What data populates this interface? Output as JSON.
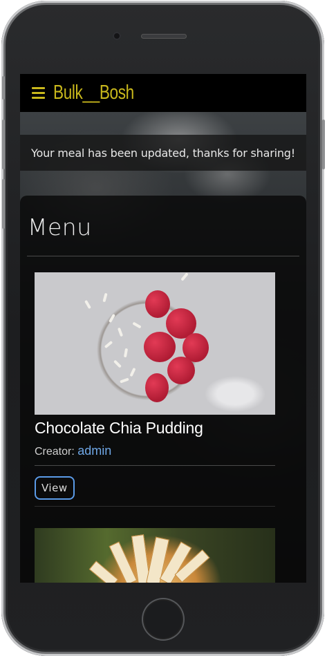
{
  "navbar": {
    "brand": "Bulk__Bosh",
    "brand_color": "#c9b81c"
  },
  "flash": {
    "message": "Your meal has been updated, thanks for sharing!"
  },
  "menu": {
    "title": "Menu",
    "recipes": [
      {
        "title": "Chocolate Chia Pudding",
        "creator_label": "Creator:",
        "creator": "admin",
        "view_label": "View"
      }
    ]
  },
  "colors": {
    "link": "#6fa7e6",
    "button_border": "#5b9be8"
  },
  "icons": {
    "menu": "hamburger-icon"
  }
}
